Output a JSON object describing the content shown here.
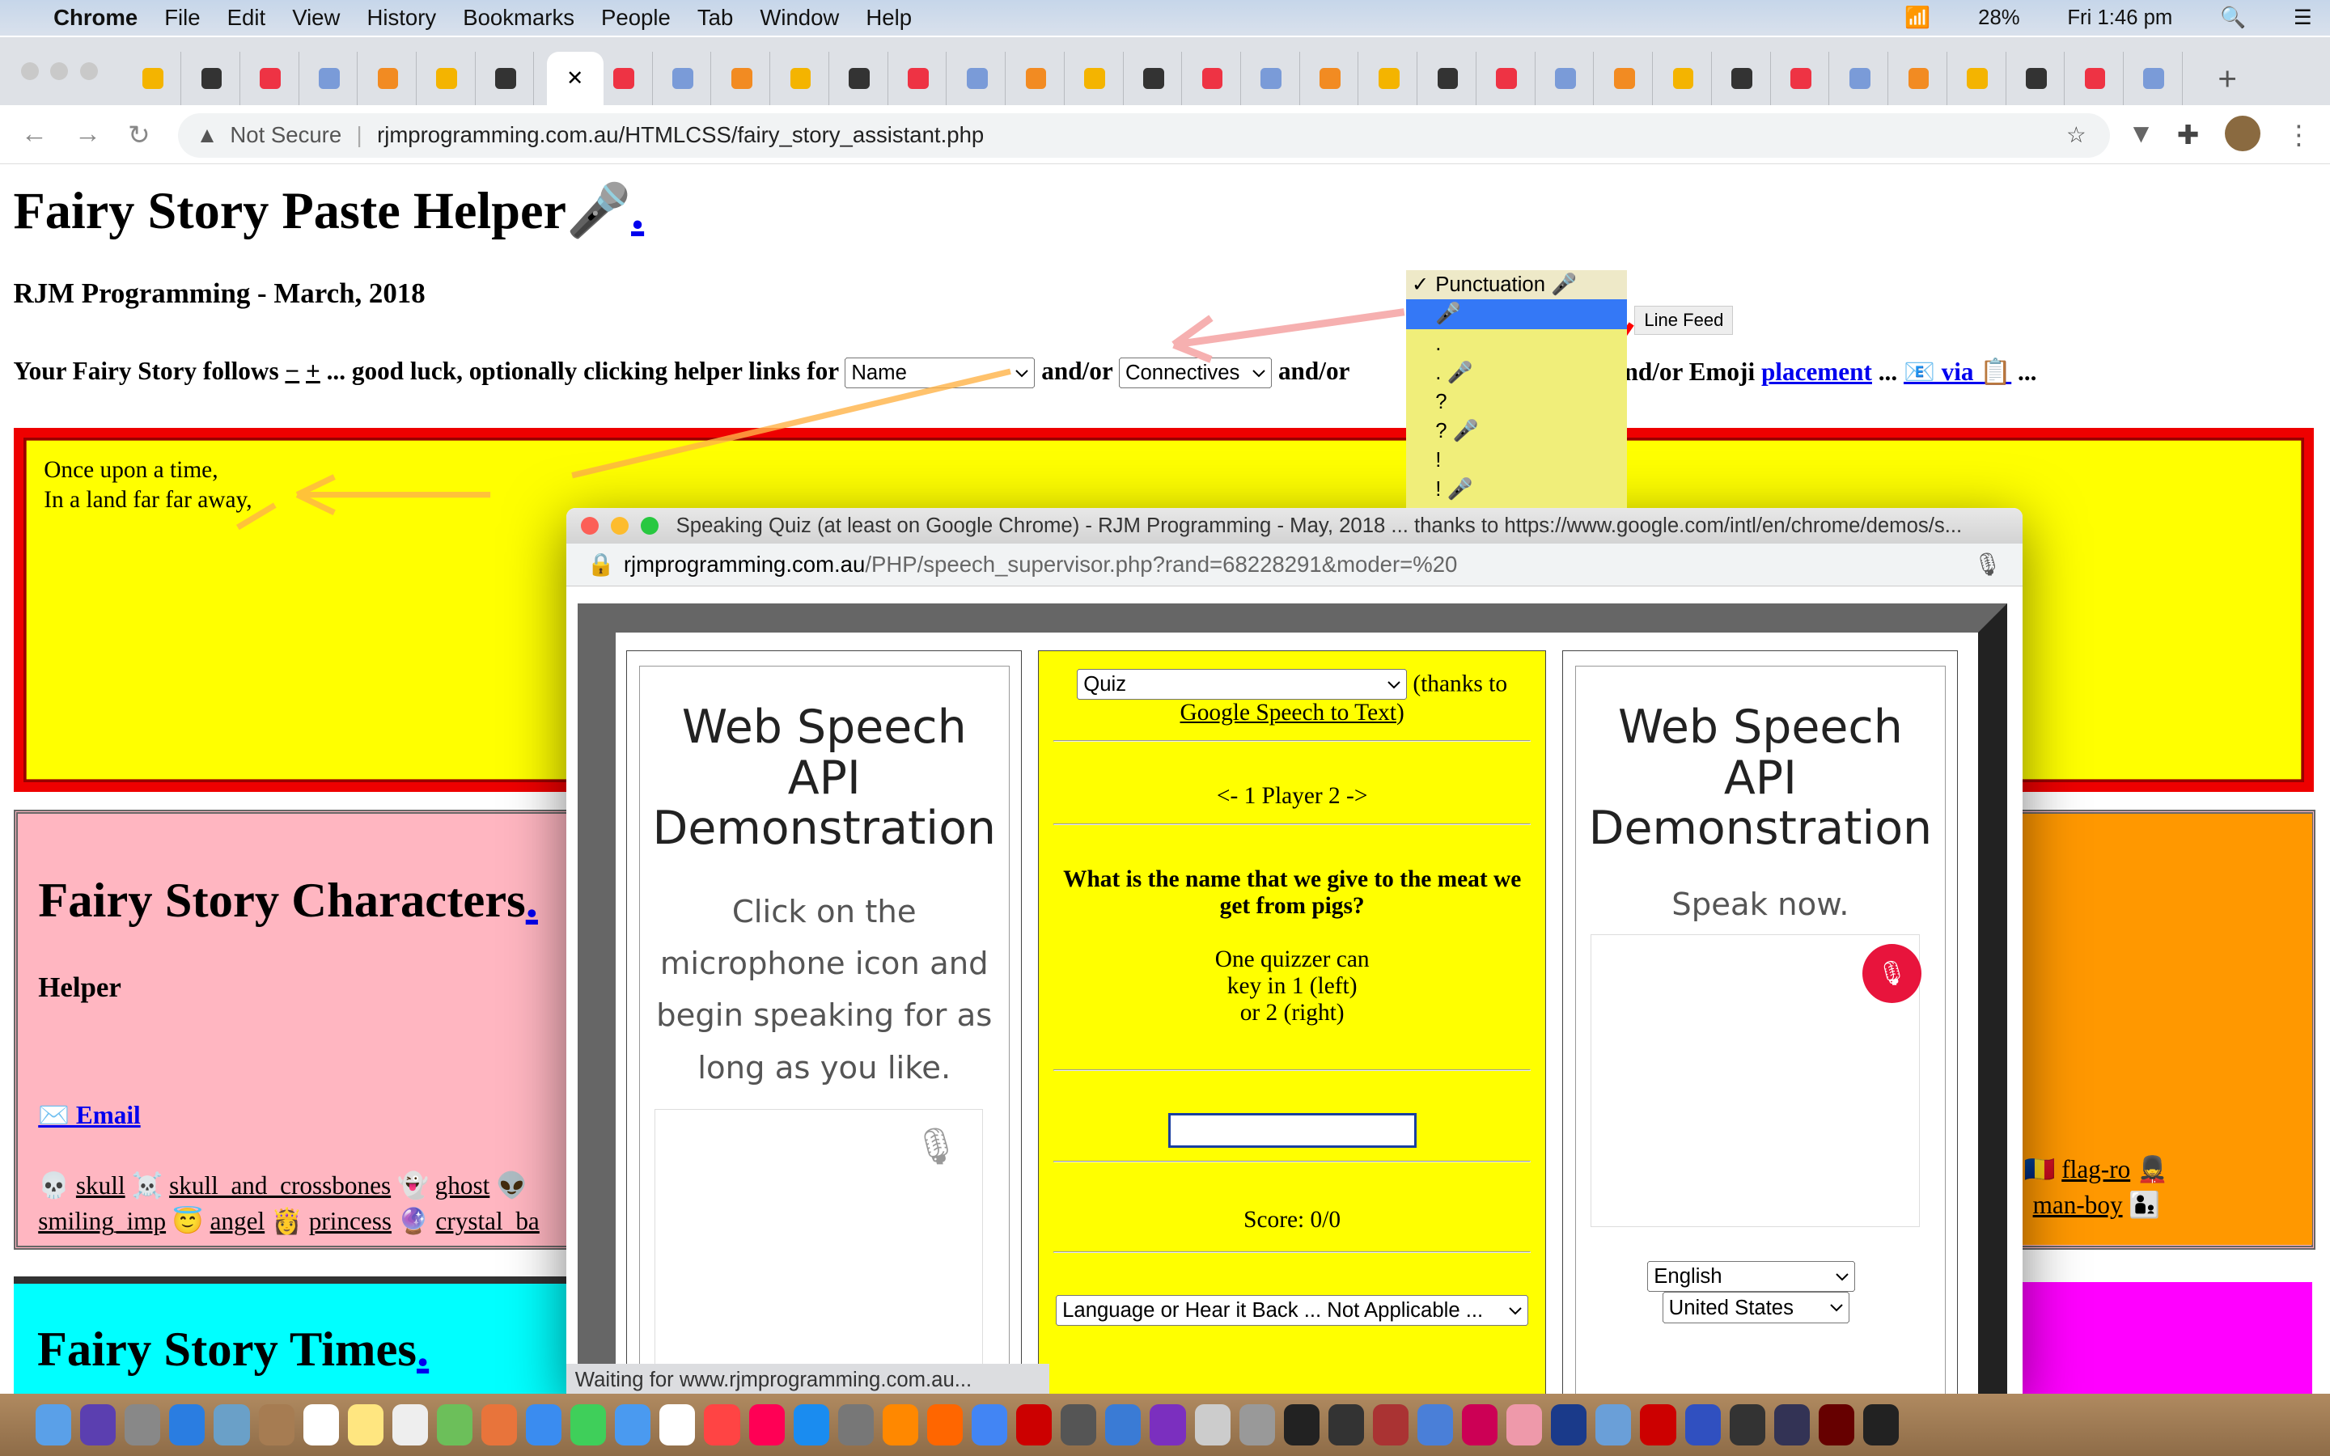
{
  "menubar": {
    "app": "Chrome",
    "items": [
      "File",
      "Edit",
      "View",
      "History",
      "Bookmarks",
      "People",
      "Tab",
      "Window",
      "Help"
    ],
    "battery": "28%",
    "clock": "Fri 1:46 pm"
  },
  "browser": {
    "not_secure": "Not Secure",
    "url": "rjmprogramming.com.au/HTMLCSS/fairy_story_assistant.php",
    "tab_close": "✕",
    "new_tab": "+"
  },
  "page": {
    "title": "Fairy Story Paste Helper🎤",
    "title_link": ".",
    "subtitle": "RJM Programming - March, 2018",
    "follows": "Your Fairy Story follows",
    "minus": "−",
    "plus": "+",
    "good_luck": "... good luck, optionally clicking helper links for",
    "select_name": "Name",
    "andor1": "and/or",
    "select_connectives": "Connectives",
    "andor2": "and/or",
    "andor_emoji": "nd/or Emoji",
    "placement": "placement",
    "ellipsis1": "...",
    "via": "📧 via 📋",
    "ellipsis2": "...",
    "story": [
      "Once upon a time,",
      "In a land far far away,"
    ],
    "characters_title": "Fairy Story Characters",
    "characters_link": ".",
    "helper": "Helper",
    "email": "✉️ Email",
    "emoji_row1": [
      {
        "icon": "💀",
        "label": "skull"
      },
      {
        "icon": "☠️",
        "label": "skull_and_crossbones"
      },
      {
        "icon": "👻",
        "label": "ghost"
      },
      {
        "icon": "👽",
        "label": ""
      }
    ],
    "emoji_row2": [
      {
        "icon": "",
        "label": "smiling_imp"
      },
      {
        "icon": "😇",
        "label": "angel"
      },
      {
        "icon": "👸",
        "label": "princess"
      },
      {
        "icon": "🔮",
        "label": "crystal_ba"
      }
    ],
    "right_row1": {
      "icon": "🇷🇴",
      "label": "flag-ro",
      "icon2": "💂"
    },
    "right_row2": {
      "label": "man-boy",
      "icon2": "👨‍👦"
    },
    "times_title": "Fairy Story Times",
    "times_link": "."
  },
  "dropdown": {
    "selected_check": "✓",
    "items": [
      "Punctuation 🎤",
      "🎤",
      ".",
      ". 🎤",
      "?",
      "? 🎤",
      "!",
      "! 🎤"
    ],
    "highlighted_index": 1,
    "tooltip": "Line Feed"
  },
  "popup": {
    "title": "Speaking Quiz (at least on Google Chrome) - RJM Programming - May, 2018 ... thanks to https://www.google.com/intl/en/chrome/demos/s...",
    "url_host": "rjmprogramming.com.au",
    "url_path": "/PHP/speech_supervisor.php?rand=68228291&moder=%20",
    "left": {
      "heading": "Web Speech API Demonstration",
      "info": "Click on the microphone icon and begin speaking for as long as you like."
    },
    "middle": {
      "mode": "Quiz",
      "thanks": "(thanks to",
      "link": "Google Speech to Text",
      ")": ")",
      "players": "<- 1 Player 2 ->",
      "question": "What is the name that we give to the meat we get from pigs?",
      "instructions": [
        "One quizzer can",
        "key in 1 (left)",
        "or 2 (right)"
      ],
      "answer_value": "",
      "score": "Score: 0/0",
      "language_select": "Language or Hear it Back ... Not Applicable ..."
    },
    "right": {
      "heading": "Web Speech API Demonstration",
      "info": "Speak now.",
      "language": "English",
      "dialect": "United States"
    },
    "status": "Waiting for www.rjmprogramming.com.au..."
  },
  "colors": {
    "story_bg": "#ffff00",
    "story_border": "#ee0000",
    "pink": "#ffb6c1",
    "orange": "#ff9800",
    "cyan": "#00ffff",
    "magenta": "#ff00ff",
    "mic_red": "#e8143c",
    "highlight": "#3478f6"
  }
}
